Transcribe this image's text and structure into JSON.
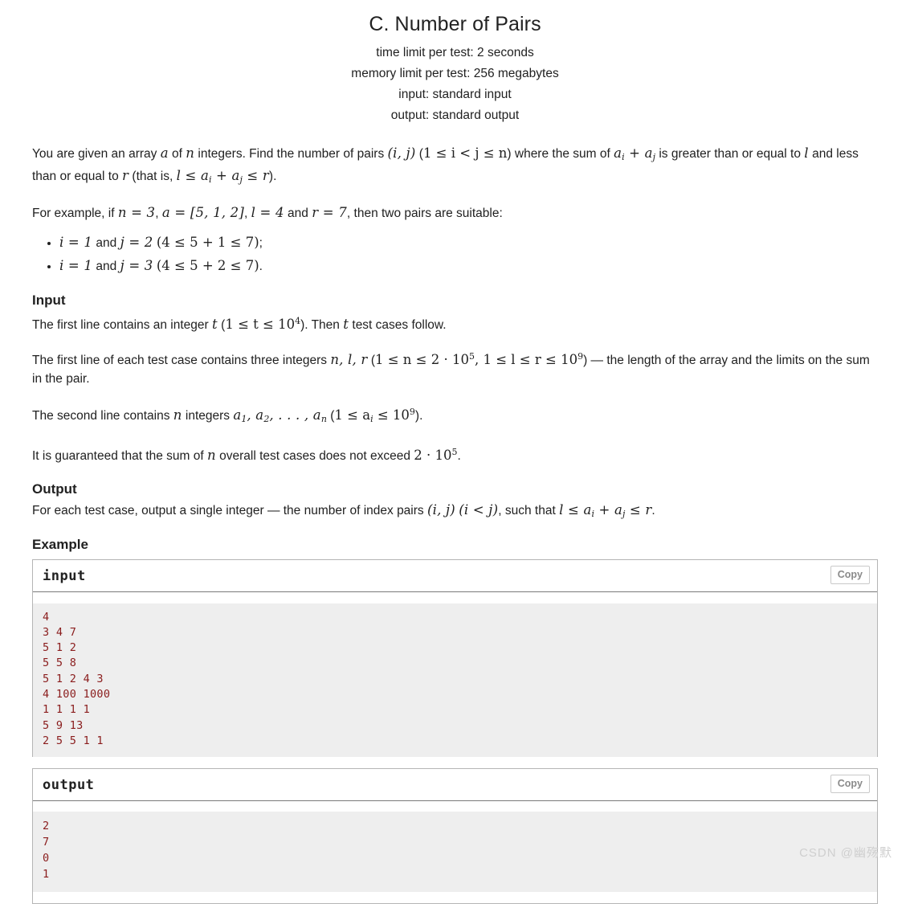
{
  "header": {
    "title": "C. Number of Pairs",
    "limits": [
      "time limit per test: 2 seconds",
      "memory limit per test: 256 megabytes",
      "input: standard input",
      "output: standard output"
    ]
  },
  "statement": {
    "p1": {
      "t1": "You are given an array ",
      "m1": "a",
      "t2": " of ",
      "m2": "n",
      "t3": " integers. Find the number of pairs ",
      "m3": "(i, j)",
      "t4": " (",
      "m4": "1 ≤ i < j ≤ n",
      "t5": ") where the sum of ",
      "m5": "a",
      "m5s": "i",
      "m5b": " + a",
      "m5bs": "j",
      "t6": " is greater than or equal to ",
      "m6": "l",
      "t7": " and less than or equal to ",
      "m7": "r",
      "t8": " (that is, ",
      "m8": "l ≤ a",
      "m8s": "i",
      "m8b": " + a",
      "m8bs": "j",
      "m8c": " ≤ r",
      "t9": ")."
    },
    "p2": {
      "t1": "For example, if ",
      "m1": "n = 3",
      "t2": ", ",
      "m2": "a = [5, 1, 2]",
      "t3": ", ",
      "m3": "l = 4",
      "t4": " and ",
      "m4": "r = 7",
      "t5": ", then two pairs are suitable:"
    },
    "bullets": [
      {
        "m1": "i = 1",
        "t1": " and ",
        "m2": "j = 2",
        "t2": " ",
        "m3": "(4 ≤ 5 + 1 ≤ 7)",
        "t3": ";"
      },
      {
        "m1": "i = 1",
        "t1": " and ",
        "m2": "j = 3",
        "t2": " ",
        "m3": "(4 ≤ 5 + 2 ≤ 7)",
        "t3": "."
      }
    ],
    "input_title": "Input",
    "input_p1": {
      "t1": "The first line contains an integer ",
      "m1": "t",
      "t2": " (",
      "m2": "1 ≤ t ≤ 10",
      "m2sup": "4",
      "t3": "). Then ",
      "m3": "t",
      "t4": " test cases follow."
    },
    "input_p2": {
      "t1": "The first line of each test case contains three integers ",
      "m1": "n, l, r",
      "t2": " (",
      "m2": "1 ≤ n ≤ 2 · 10",
      "m2sup": "5",
      "m3": ", 1 ≤ l ≤ r ≤ 10",
      "m3sup": "9",
      "t3": ") — the length of the array and the limits on the sum in the pair."
    },
    "input_p3": {
      "t1": "The second line contains ",
      "m1": "n",
      "t2": " integers ",
      "m2": "a",
      "m2sub": "1",
      "m2b": ", a",
      "m2bsub": "2",
      "m2c": ", . . . , a",
      "m2csub": "n",
      "t3": " (",
      "m3": "1 ≤ a",
      "m3sub": "i",
      "m3b": " ≤ 10",
      "m3sup": "9",
      "t4": ")."
    },
    "input_p4": {
      "t1": "It is guaranteed that the sum of ",
      "m1": "n",
      "t2": " overall test cases does not exceed ",
      "m2": "2 · 10",
      "m2sup": "5",
      "t3": "."
    },
    "output_title": "Output",
    "output_p1": {
      "t1": "For each test case, output a single integer — the number of index pairs ",
      "m1": "(i, j)",
      "t2": " ",
      "m2": "(i < j)",
      "t3": ", such that ",
      "m3": "l ≤ a",
      "m3sub": "i",
      "m3b": " + a",
      "m3bsub": "j",
      "m3c": " ≤ r",
      "t4": "."
    }
  },
  "example": {
    "title": "Example",
    "copy_label": "Copy",
    "input": {
      "label": "input",
      "data": "4\n3 4 7\n5 1 2\n5 5 8\n5 1 2 4 3\n4 100 1000\n1 1 1 1\n5 9 13\n2 5 5 1 1"
    },
    "output": {
      "label": "output",
      "data": "2\n7\n0\n1"
    }
  },
  "watermark": "CSDN @幽殇默"
}
